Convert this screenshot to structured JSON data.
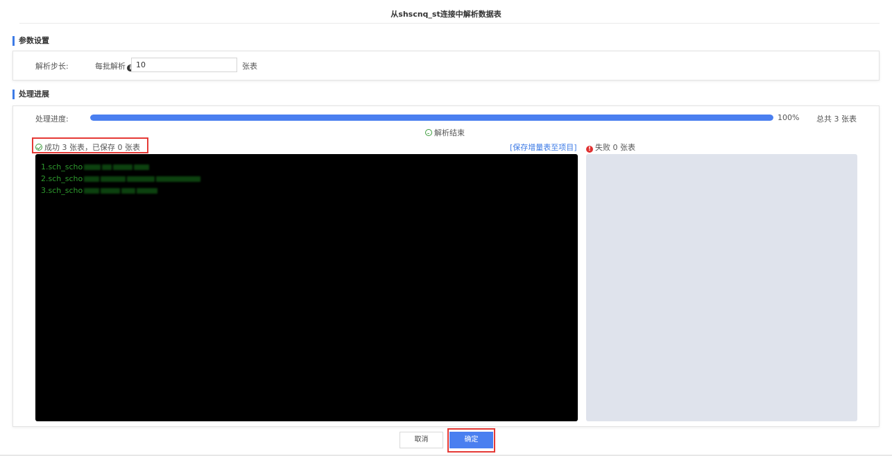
{
  "dialog": {
    "title": "从shscnq_st连接中解析数据表"
  },
  "params_section": {
    "heading": "参数设置",
    "step_label": "解析步长:",
    "batch_label": "每批解析",
    "batch_value": "10",
    "unit": "张表"
  },
  "progress_section": {
    "heading": "处理进展",
    "progress_label": "处理进度:",
    "progress_percent": 100,
    "progress_text": "100%",
    "total_text": "总共 3 张表",
    "status_text": "解析结束",
    "success_text": "成功 3 张表，已保存 0 张表",
    "save_link": "[保存增量表至项目]",
    "fail_text": "失败 0 张表",
    "console_lines": [
      "1.sch_scho",
      "2.sch_scho",
      "3.sch_scho"
    ]
  },
  "footer": {
    "cancel_label": "取消",
    "ok_label": "确定"
  },
  "colors": {
    "accent": "#4a7ff0",
    "success": "#3a9a3a",
    "error": "#e03030",
    "highlight": "#e53935"
  }
}
